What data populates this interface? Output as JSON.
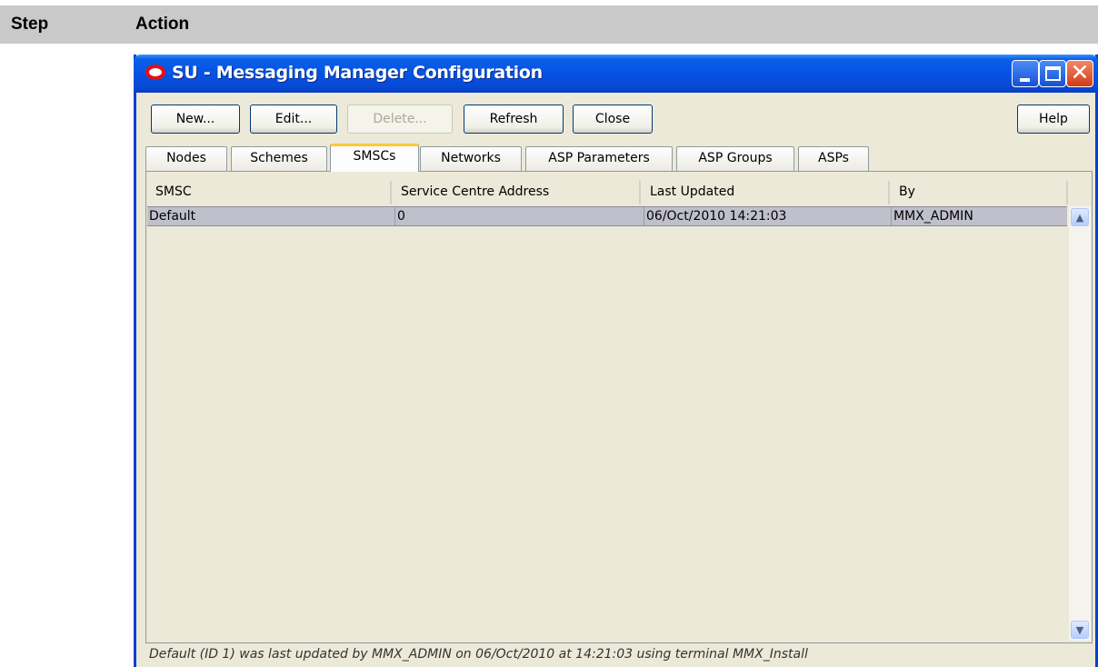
{
  "doc_header": {
    "step": "Step",
    "action": "Action"
  },
  "window": {
    "title": "SU - Messaging Manager Configuration",
    "controls": {
      "close_glyph": "✕"
    }
  },
  "toolbar": {
    "new_label": "New...",
    "edit_label": "Edit...",
    "delete_label": "Delete...",
    "refresh_label": "Refresh",
    "close_label": "Close",
    "help_label": "Help"
  },
  "tabs": [
    {
      "label": "Nodes"
    },
    {
      "label": "Schemes"
    },
    {
      "label": "SMSCs",
      "active": true
    },
    {
      "label": "Networks"
    },
    {
      "label": "ASP Parameters"
    },
    {
      "label": "ASP Groups"
    },
    {
      "label": "ASPs"
    }
  ],
  "table": {
    "columns": [
      "SMSC",
      "Service Centre Address",
      "Last Updated",
      "By"
    ],
    "rows": [
      {
        "smsc": "Default",
        "address": "0",
        "updated": "06/Oct/2010 14:21:03",
        "by": "MMX_ADMIN"
      }
    ]
  },
  "scroll": {
    "up_glyph": "▲",
    "down_glyph": "▼"
  },
  "status": "Default (ID 1) was last updated by MMX_ADMIN on 06/Oct/2010 at 14:21:03 using terminal MMX_Install",
  "colors": {
    "titlebar": "#0553e3",
    "selected_row": "#c0c0cc",
    "active_tab_accent": "#ffc83c"
  }
}
